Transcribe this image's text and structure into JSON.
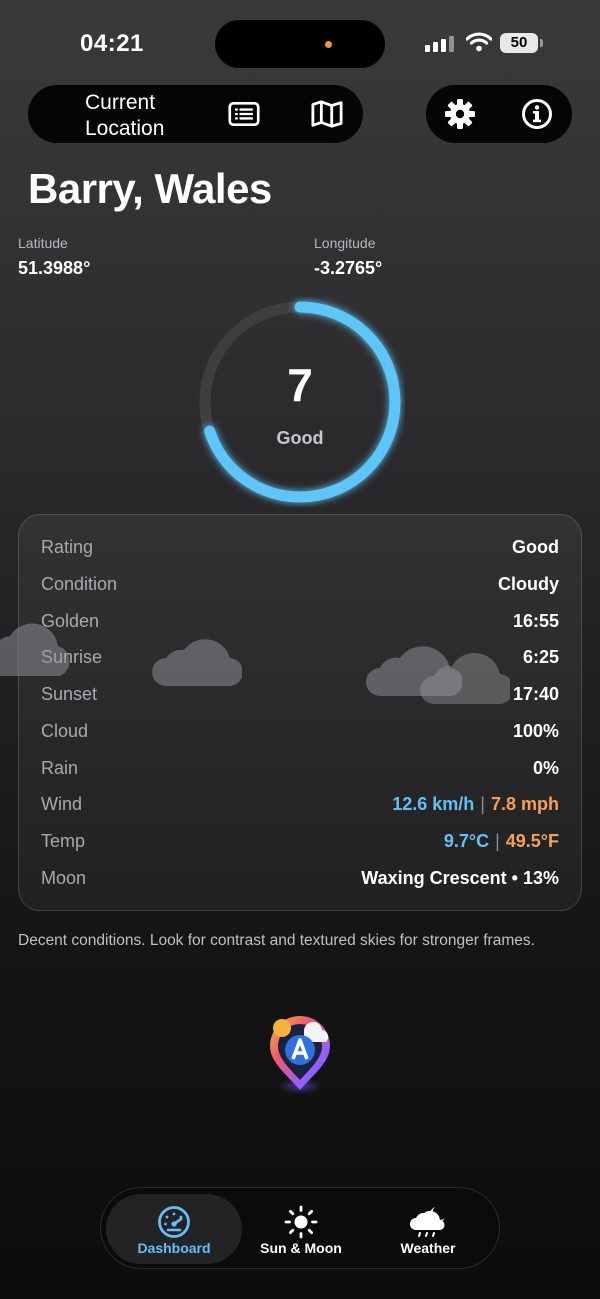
{
  "status": {
    "time": "04:21",
    "battery": "50"
  },
  "header": {
    "location_button": "Current Location",
    "list_icon": "list-icon",
    "map_icon": "map-icon",
    "settings_icon": "gear-icon",
    "info_icon": "info-icon"
  },
  "location": {
    "city": "Barry, Wales",
    "latitude_label": "Latitude",
    "latitude": "51.3988°",
    "longitude_label": "Longitude",
    "longitude": "-3.2765°"
  },
  "score": {
    "value": "7",
    "label": "Good",
    "fraction": 0.7,
    "accent": "#5ec4f8"
  },
  "details": {
    "rating_label": "Rating",
    "rating": "Good",
    "condition_label": "Condition",
    "condition": "Cloudy",
    "golden_label": "Golden",
    "golden": "16:55",
    "sunrise_label": "Sunrise",
    "sunrise": "6:25",
    "sunset_label": "Sunset",
    "sunset": "17:40",
    "cloud_label": "Cloud",
    "cloud": "100%",
    "rain_label": "Rain",
    "rain": "0%",
    "wind_label": "Wind",
    "wind_kmh": "12.6 km/h",
    "wind_mph": "7.8 mph",
    "temp_label": "Temp",
    "temp_c": "9.7°C",
    "temp_f": "49.5°F",
    "moon_label": "Moon",
    "moon": "Waxing Crescent • 13%"
  },
  "note": "Decent conditions. Look for contrast and textured skies for stronger frames.",
  "tabs": [
    {
      "label": "Dashboard",
      "icon": "gauge-icon",
      "active": true
    },
    {
      "label": "Sun & Moon",
      "icon": "sun-icon",
      "active": false
    },
    {
      "label": "Weather",
      "icon": "cloud-moon-rain-icon",
      "active": false
    }
  ],
  "colors": {
    "blue": "#63c0f5",
    "orange": "#f2a05c"
  }
}
